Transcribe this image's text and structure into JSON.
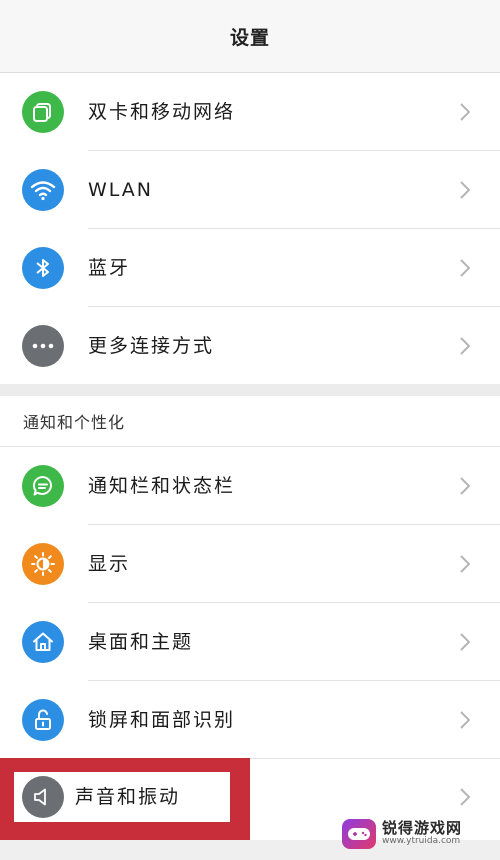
{
  "header": {
    "title": "设置"
  },
  "colors": {
    "green": "#3fb84a",
    "blue": "#2d8fe3",
    "gray": "#6b6e73",
    "orange": "#f08a1c",
    "highlight_red": "#c82d3a"
  },
  "group1": {
    "items": [
      {
        "label": "双卡和移动网络",
        "icon": "sim-card-icon"
      },
      {
        "label": "WLAN",
        "icon": "wifi-icon"
      },
      {
        "label": "蓝牙",
        "icon": "bluetooth-icon"
      },
      {
        "label": "更多连接方式",
        "icon": "more-dots-icon"
      }
    ]
  },
  "group2": {
    "section_title": "通知和个性化",
    "items": [
      {
        "label": "通知栏和状态栏",
        "icon": "notification-bubble-icon"
      },
      {
        "label": "显示",
        "icon": "brightness-icon"
      },
      {
        "label": "桌面和主题",
        "icon": "home-icon"
      },
      {
        "label": "锁屏和面部识别",
        "icon": "lock-icon"
      },
      {
        "label": "声音和振动",
        "icon": "speaker-icon"
      }
    ]
  },
  "watermark": {
    "name": "锐得游戏网",
    "url": "www.ytruida.com"
  }
}
